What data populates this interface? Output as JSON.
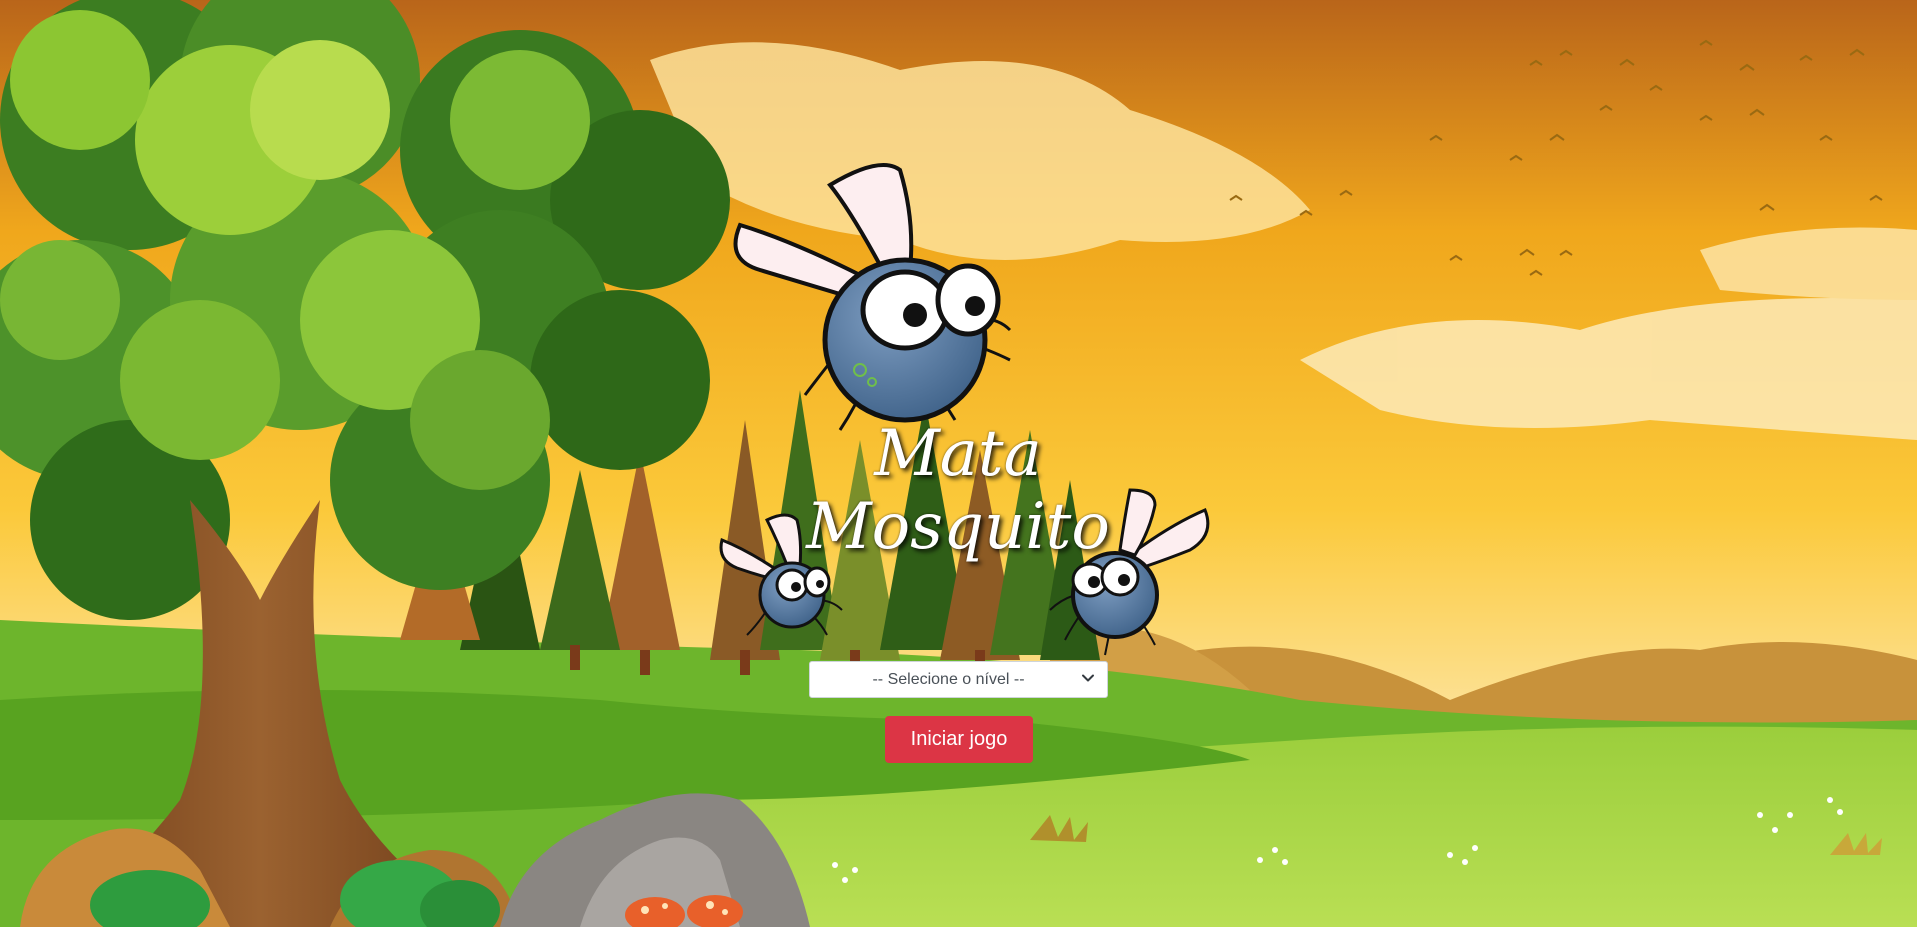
{
  "game": {
    "title_line1": "Mata",
    "title_line2": "Mosquito"
  },
  "menu": {
    "level_select": {
      "selected": "-- Selecione o nível --",
      "options": [
        "-- Selecione o nível --"
      ]
    },
    "start_label": "Iniciar jogo"
  },
  "icons": {
    "select_arrow": "chevron-down-icon",
    "mosquito": "mosquito-icon"
  },
  "colors": {
    "start_button": "#dc3545",
    "sky_top": "#c36a12",
    "sky_mid": "#f5b41a",
    "sky_low": "#fde29a",
    "grass_light": "#b8dc4e",
    "grass_dark": "#5aa824",
    "tree_dark": "#3c7d21",
    "tree_light": "#9ccf3a",
    "trunk": "#8a5326",
    "mosquito_body": "#5a7fa6"
  }
}
